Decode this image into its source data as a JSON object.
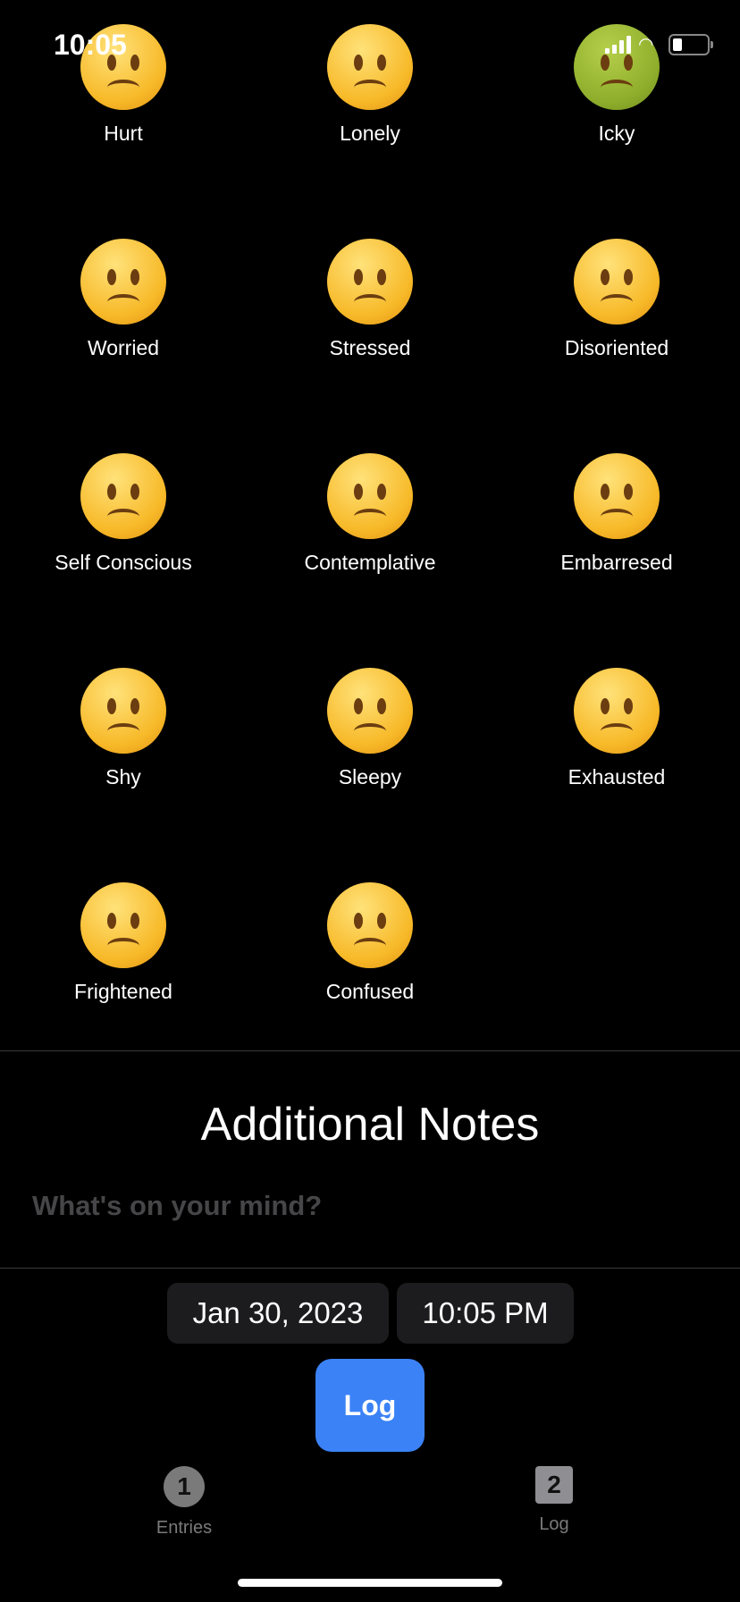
{
  "status_bar": {
    "time": "10:05",
    "icons": [
      "cellular-signal-icon",
      "wifi-icon",
      "battery-low-icon"
    ]
  },
  "moods": [
    {
      "label": "Hurt",
      "icon": "pleading-face-icon",
      "color": "#f7b928"
    },
    {
      "label": "Lonely",
      "icon": "frowning-face-icon",
      "color": "#f7b928"
    },
    {
      "label": "Icky",
      "icon": "nauseated-face-icon",
      "color": "#8fae2c"
    },
    {
      "label": "Worried",
      "icon": "confounded-face-icon",
      "color": "#f7b928"
    },
    {
      "label": "Stressed",
      "icon": "weary-face-icon",
      "color": "#f7b928"
    },
    {
      "label": "Disoriented",
      "icon": "spiral-eyes-face-icon",
      "color": "#f7b928"
    },
    {
      "label": "Self Conscious",
      "icon": "face-with-peeking-eye-icon",
      "color": "#f7b928"
    },
    {
      "label": "Contemplative",
      "icon": "thinking-face-icon",
      "color": "#f7b928"
    },
    {
      "label": "Embarresed",
      "icon": "anxious-face-with-sweat-icon",
      "color": "#f7b928"
    },
    {
      "label": "Shy",
      "icon": "zipper-mouth-face-icon",
      "color": "#f7b928"
    },
    {
      "label": "Sleepy",
      "icon": "sleeping-face-icon",
      "color": "#f7b928"
    },
    {
      "label": "Exhausted",
      "icon": "face-exhaling-icon",
      "color": "#f7b928"
    },
    {
      "label": "Frightened",
      "icon": "face-screaming-in-fear-icon",
      "color": "#f7b928"
    },
    {
      "label": "Confused",
      "icon": "face-with-raised-eyebrow-icon",
      "color": "#f7b928"
    }
  ],
  "notes": {
    "title": "Additional Notes",
    "placeholder": "What's on your mind?",
    "value": ""
  },
  "date": "Jan 30, 2023",
  "time": "10:05 PM",
  "log_button": "Log",
  "accent": "#3b82f6",
  "tabs": [
    {
      "label": "Entries",
      "badge": "1",
      "icon": "number-1-circle-icon"
    },
    {
      "label": "Log",
      "badge": "2",
      "icon": "number-2-square-icon"
    }
  ]
}
